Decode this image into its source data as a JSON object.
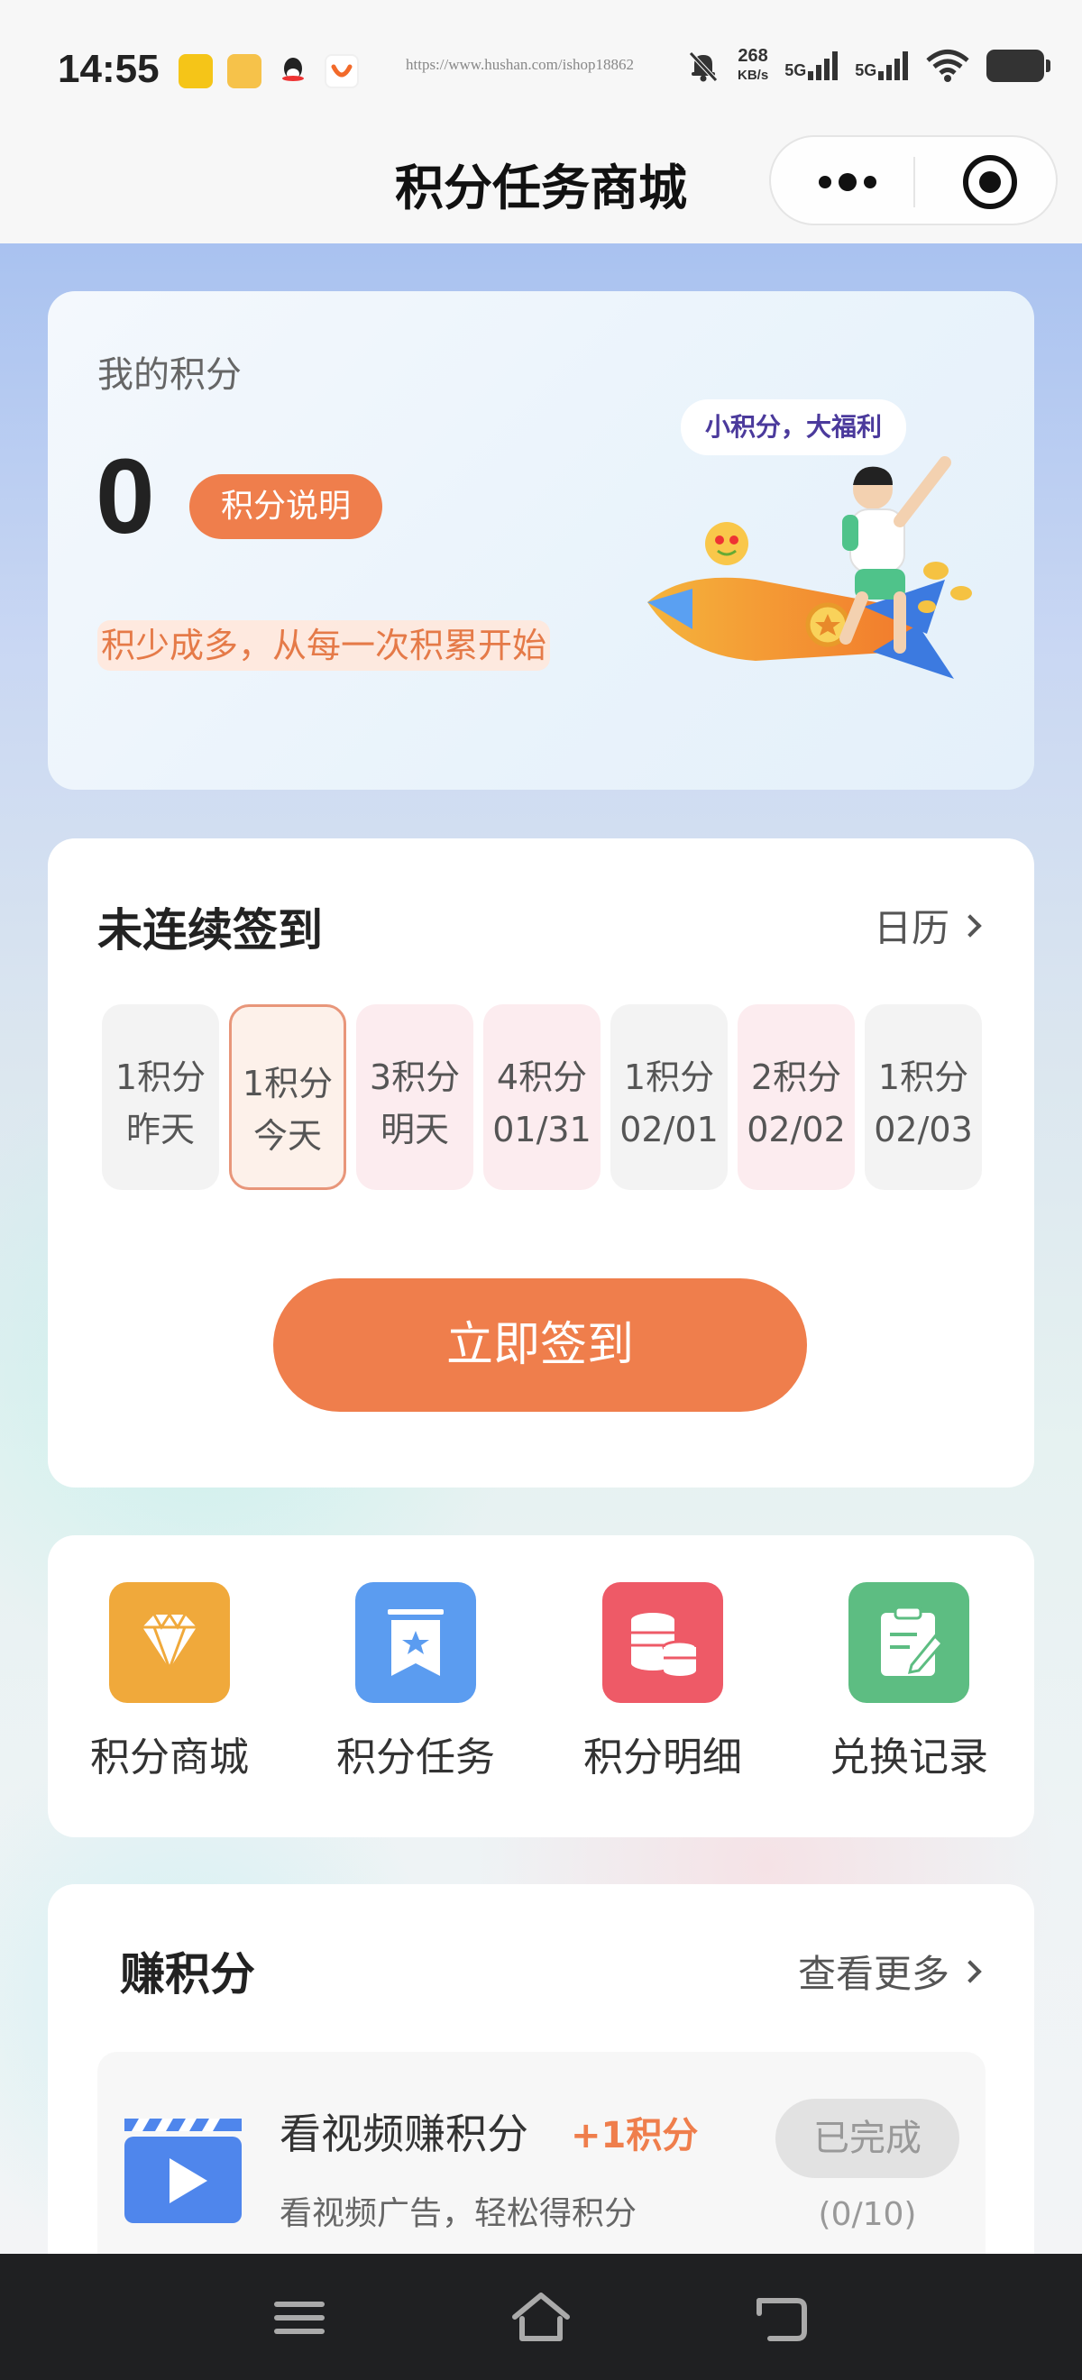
{
  "status_bar": {
    "time": "14:55",
    "url_text": "https://www.hushan.com/ishop18862",
    "speed_value": "268",
    "speed_unit": "KB/s",
    "net1": "5G",
    "net2": "5G",
    "icons": [
      "app-notification-icon-yellow",
      "app-notification-icon-hand",
      "qq-icon",
      "app-notification-icon-orange",
      "bell-muted-icon",
      "signal-icon",
      "signal-icon",
      "wifi-icon",
      "battery-icon"
    ]
  },
  "nav": {
    "title": "积分任务商城",
    "icons": [
      "more-dots-icon",
      "target-icon"
    ]
  },
  "points": {
    "label": "我的积分",
    "value": "0",
    "explain_label": "积分说明",
    "slogan": "积少成多，从每一次积累开始",
    "bubble": "小积分，大福利"
  },
  "sign_in": {
    "title": "未连续签到",
    "calendar_label": "日历",
    "days": [
      {
        "points": "1积分",
        "day": "昨天",
        "style": "gray"
      },
      {
        "points": "1积分",
        "day": "今天",
        "style": "today"
      },
      {
        "points": "3积分",
        "day": "明天",
        "style": "pink"
      },
      {
        "points": "4积分",
        "day": "01/31",
        "style": "pink"
      },
      {
        "points": "1积分",
        "day": "02/01",
        "style": "gray"
      },
      {
        "points": "2积分",
        "day": "02/02",
        "style": "pink"
      },
      {
        "points": "1积分",
        "day": "02/03",
        "style": "gray"
      }
    ],
    "button_label": "立即签到"
  },
  "shortcuts": [
    {
      "label": "积分商城",
      "icon": "diamond-icon",
      "color": "#f0a93b"
    },
    {
      "label": "积分任务",
      "icon": "star-ribbon-icon",
      "color": "#5b9cf0"
    },
    {
      "label": "积分明细",
      "icon": "coins-icon",
      "color": "#ee5a67"
    },
    {
      "label": "兑换记录",
      "icon": "clipboard-edit-icon",
      "color": "#5dbd82"
    }
  ],
  "earn": {
    "title": "赚积分",
    "more_label": "查看更多",
    "task": {
      "name": "看视频赚积分",
      "reward": "+1积分",
      "desc": "看视频广告，轻松得积分",
      "status": "已完成",
      "progress": "(0/10)",
      "icon": "video-play-icon"
    }
  },
  "bottom_nav": {
    "icons": [
      "menu-icon",
      "home-icon",
      "back-icon"
    ]
  },
  "colors": {
    "accent": "#ef7e4c",
    "today_border": "#e8967a",
    "pink_tile": "#fcecef",
    "gray_tile": "#f3f3f3"
  }
}
